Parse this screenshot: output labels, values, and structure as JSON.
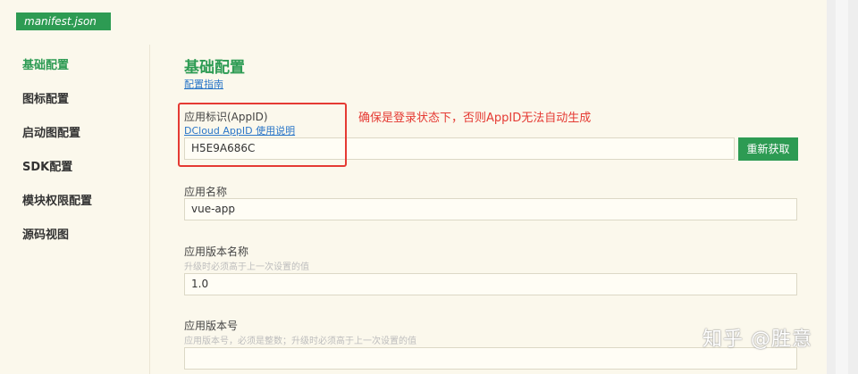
{
  "file_tab": {
    "label": "manifest.json"
  },
  "sidebar": {
    "items": [
      {
        "label": "基础配置",
        "active": true
      },
      {
        "label": "图标配置"
      },
      {
        "label": "启动图配置"
      },
      {
        "label": "SDK配置"
      },
      {
        "label": "模块权限配置"
      },
      {
        "label": "源码视图"
      }
    ]
  },
  "main": {
    "title": "基础配置",
    "guide_link": "配置指南",
    "appid": {
      "label": "应用标识(AppID)",
      "help_link": "DCloud AppID 使用说明",
      "value": "H5E9A686C",
      "refresh_label": "重新获取"
    },
    "app_name": {
      "label": "应用名称",
      "value": "vue-app"
    },
    "version_name": {
      "label": "应用版本名称",
      "hint": "升级时必须高于上一次设置的值",
      "value": "1.0"
    },
    "version_code": {
      "label": "应用版本号",
      "hint": "应用版本号，必须是整数；升级时必须高于上一次设置的值",
      "value": ""
    }
  },
  "annotation": {
    "text": "确保是登录状态下，否则AppID无法自动生成",
    "color": "#e53a33"
  },
  "watermark": {
    "text": "知乎 @胜意"
  },
  "colors": {
    "accent": "#2d9b53",
    "link": "#2a76c8",
    "background": "#fbf8ec"
  }
}
